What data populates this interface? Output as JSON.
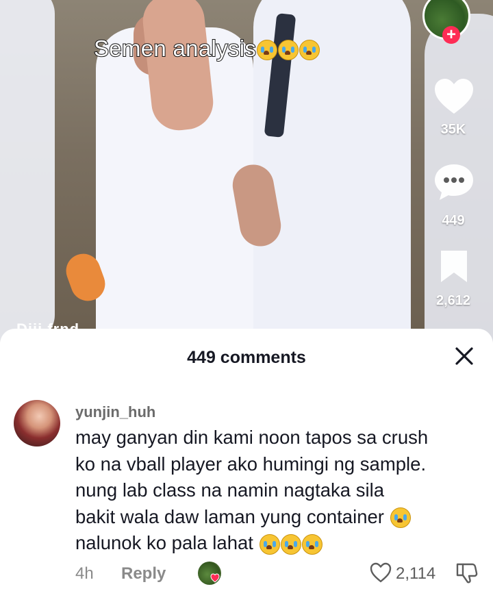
{
  "video": {
    "caption": "Semen analysis",
    "caption_emojis": [
      "loudly-crying-face",
      "loudly-crying-face",
      "loudly-crying-face"
    ],
    "background_overlay_text": "Diii frnd..."
  },
  "rail": {
    "likes": "35K",
    "comments": "449",
    "saves": "2,612",
    "follow_symbol": "+",
    "accent_color": "#fe2c55"
  },
  "comments_sheet": {
    "title": "449 comments",
    "close_symbol": "×"
  },
  "comment": {
    "username": "yunjin_huh",
    "lines": [
      "may ganyan din kami noon tapos sa crush",
      "ko na vball player ako humingi ng sample.",
      "nung lab class na namin nagtaka sila",
      "bakit wala daw laman yung container",
      "nalunok ko pala lahat"
    ],
    "line4_emoji": "loudly-crying-face",
    "line5_emojis": [
      "loudly-crying-face",
      "loudly-crying-face",
      "loudly-crying-face"
    ],
    "time": "4h",
    "reply_label": "Reply",
    "likes": "2,114",
    "creator_liked": true
  }
}
